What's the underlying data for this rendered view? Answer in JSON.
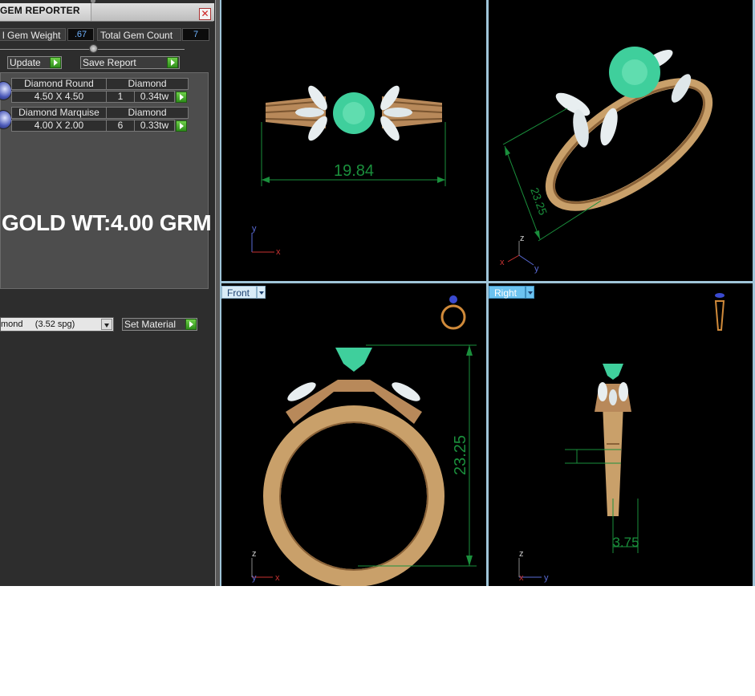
{
  "panel": {
    "title": "GEM REPORTER",
    "close_icon": "close-icon",
    "total_gem_weight_label": "l Gem Weight",
    "total_gem_weight_value": ".67",
    "total_gem_count_label": "Total Gem Count",
    "total_gem_count_value": "7",
    "update_label": "Update",
    "save_report_label": "Save Report",
    "gems": [
      {
        "name": "Diamond Round",
        "material": "Diamond",
        "size": "4.50 X 4.50",
        "count": "1",
        "weight": "0.34tw"
      },
      {
        "name": "Diamond Marquise",
        "material": "Diamond",
        "size": "4.00 X 2.00",
        "count": "6",
        "weight": "0.33tw"
      }
    ],
    "gold_weight": "GOLD WT:4.00 GRM",
    "material_select": "mond     (3.52 spg)",
    "set_material_label": "Set Material"
  },
  "viewports": {
    "top": {
      "dimension": "19.84",
      "axis_y": "y",
      "axis_x": "x"
    },
    "perspective": {
      "dimension": "23.25",
      "axis_z": "z",
      "axis_x": "x",
      "axis_y": "y"
    },
    "front": {
      "label": "Front",
      "dimension": "23.25",
      "axis_z": "z",
      "axis_y": "y",
      "axis_x": "x"
    },
    "right": {
      "label": "Right",
      "dimension": "3.75",
      "axis_z": "z",
      "axis_y": "y",
      "axis_x": "x"
    }
  },
  "colors": {
    "gold": "#c9a06a",
    "emerald": "#3fcf9c",
    "dimension_green": "#1a8f3c",
    "viewport_border": "#9fc4d8"
  }
}
